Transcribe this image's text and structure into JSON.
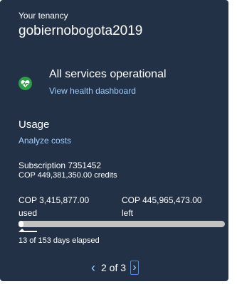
{
  "tenancy": {
    "label": "Your tenancy",
    "name": "gobiernobogota2019"
  },
  "health": {
    "icon": "heart-pulse-icon",
    "icon_color": "#2e9e48",
    "status": "All services operational",
    "link": "View health dashboard"
  },
  "usage": {
    "title": "Usage",
    "link": "Analyze costs",
    "subscription": "Subscription 7351452",
    "credits": "COP 449,381,350.00 credits",
    "used_amount": "COP 3,415,877.00",
    "used_label": "used",
    "left_amount": "COP 445,965,473.00",
    "left_label": "left",
    "used_fraction": 0.0076,
    "days_elapsed": "13 of 153 days elapsed"
  },
  "pager": {
    "prev_icon": "chevron-left-icon",
    "next_icon": "chevron-right-icon",
    "text": "2 of 3"
  },
  "colors": {
    "card_background": "#233147",
    "link": "#9ed0ff",
    "track": "#c2c2c2"
  }
}
